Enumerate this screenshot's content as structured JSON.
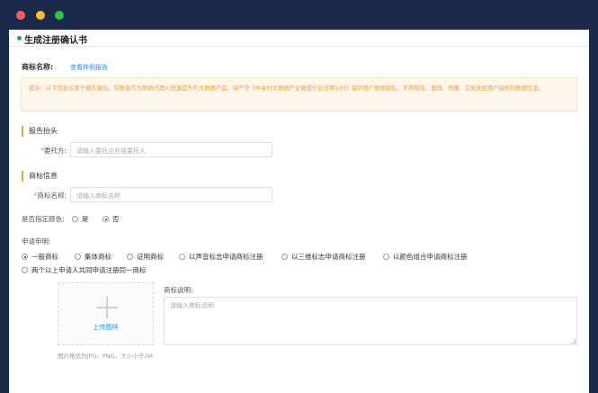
{
  "header": {
    "title": "生成注册确认书"
  },
  "trademark": {
    "label": "商标名称:",
    "sample_link": "查看样例报告"
  },
  "tip": {
    "line1": "提示：以下信息仅用于报告输出，知数者作为帮助代理人快速提升的大数据产品，将严守《中关村大数据产业联盟行业自律公约》保护用户数据隐私，不得窥视、篡改、传播、交易未经用户授权的数据信息。",
    "line2": ""
  },
  "report_header": {
    "section_title": "报告抬头",
    "client_label": "委托方:",
    "client_placeholder": "请输入委托企业或委托人"
  },
  "trademark_info": {
    "section_title": "商标信息",
    "name_label": "商标名称:",
    "name_placeholder": "请输入商标名称",
    "color_label": "是否指定颜色:",
    "color_options": [
      {
        "label": "是",
        "selected": false
      },
      {
        "label": "否",
        "selected": true
      }
    ]
  },
  "declaration": {
    "label": "申请申明:",
    "options": [
      {
        "label": "一般商标",
        "selected": true
      },
      {
        "label": "集体商标",
        "selected": false
      },
      {
        "label": "证明商标",
        "selected": false
      },
      {
        "label": "以声音标志申请商标注册",
        "selected": false
      },
      {
        "label": "以三维标志申请商标注册",
        "selected": false
      },
      {
        "label": "以颜色组合申请商标注册",
        "selected": false
      },
      {
        "label": "两个以上申请人共同申请注册同一商标",
        "selected": false
      }
    ]
  },
  "upload": {
    "button_label": "上传图样",
    "hint": "图片格式为JPG、PNG，大小小于2M"
  },
  "description": {
    "label": "商标说明:",
    "placeholder": "请输入商标说明"
  },
  "colors": {
    "accent_blue": "#2d8cf0",
    "required_red": "#f56c6c",
    "tip_orange": "#e6a23c",
    "frame_navy": "#1b2a4a"
  }
}
